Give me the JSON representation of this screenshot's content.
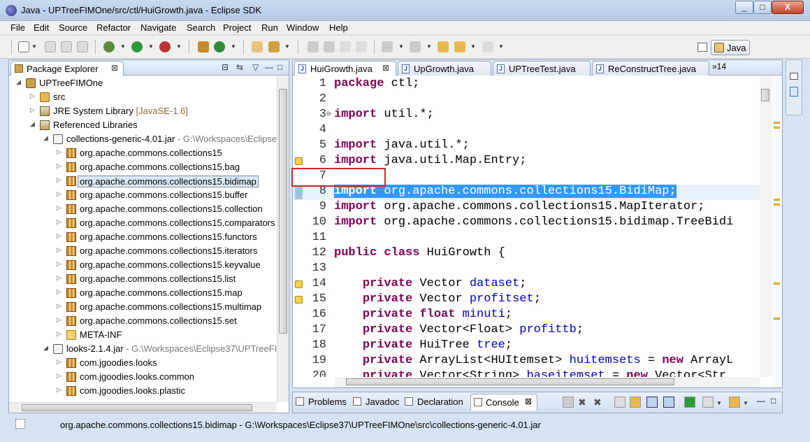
{
  "window": {
    "title": "Java - UPTreeFIMOne/src/ctl/HuiGrowth.java - Eclipse SDK",
    "controls": [
      "_",
      "□",
      "X"
    ]
  },
  "menu": [
    "File",
    "Edit",
    "Source",
    "Refactor",
    "Navigate",
    "Search",
    "Project",
    "Run",
    "Window",
    "Help"
  ],
  "perspective": {
    "label": "Java"
  },
  "package_explorer": {
    "title": "Package Explorer",
    "close": "⊠",
    "controls": [
      "⊟",
      "⇆",
      "▽",
      "—",
      "□"
    ],
    "tree": [
      {
        "label": "UPTreeFIMOne",
        "arrow": "◢",
        "icon": "project",
        "indent": 0
      },
      {
        "label": "src",
        "arrow": "▷",
        "icon": "src",
        "indent": 1
      },
      {
        "label": "JRE System Library",
        "suffix": "[JavaSE-1.6]",
        "arrow": "▷",
        "icon": "lib",
        "indent": 1
      },
      {
        "label": "Referenced Libraries",
        "arrow": "◢",
        "icon": "lib",
        "indent": 1
      },
      {
        "label": "collections-generic-4.01.jar",
        "path": " - G:\\Workspaces\\Eclipse",
        "arrow": "◢",
        "icon": "jar",
        "indent": 2
      },
      {
        "label": "org.apache.commons.collections15",
        "arrow": "▷",
        "icon": "pkg",
        "indent": 3
      },
      {
        "label": "org.apache.commons.collections15.bag",
        "arrow": "▷",
        "icon": "pkg",
        "indent": 3
      },
      {
        "label": "org.apache.commons.collections15.bidimap",
        "arrow": "▷",
        "icon": "pkg",
        "indent": 3,
        "selected": true
      },
      {
        "label": "org.apache.commons.collections15.buffer",
        "arrow": "▷",
        "icon": "pkg",
        "indent": 3
      },
      {
        "label": "org.apache.commons.collections15.collection",
        "arrow": "▷",
        "icon": "pkg",
        "indent": 3
      },
      {
        "label": "org.apache.commons.collections15.comparators",
        "arrow": "▷",
        "icon": "pkg",
        "indent": 3
      },
      {
        "label": "org.apache.commons.collections15.functors",
        "arrow": "▷",
        "icon": "pkg",
        "indent": 3
      },
      {
        "label": "org.apache.commons.collections15.iterators",
        "arrow": "▷",
        "icon": "pkg",
        "indent": 3
      },
      {
        "label": "org.apache.commons.collections15.keyvalue",
        "arrow": "▷",
        "icon": "pkg",
        "indent": 3
      },
      {
        "label": "org.apache.commons.collections15.list",
        "arrow": "▷",
        "icon": "pkg",
        "indent": 3
      },
      {
        "label": "org.apache.commons.collections15.map",
        "arrow": "▷",
        "icon": "pkg",
        "indent": 3
      },
      {
        "label": "org.apache.commons.collections15.multimap",
        "arrow": "▷",
        "icon": "pkg",
        "indent": 3
      },
      {
        "label": "org.apache.commons.collections15.set",
        "arrow": "▷",
        "icon": "pkg",
        "indent": 3
      },
      {
        "label": "META-INF",
        "arrow": "▷",
        "icon": "folder",
        "indent": 3
      },
      {
        "label": "looks-2.1.4.jar",
        "path": " - G:\\Workspaces\\Eclipse37\\UPTreeFI",
        "arrow": "◢",
        "icon": "jar",
        "indent": 2
      },
      {
        "label": "com.jgoodies.looks",
        "arrow": "▷",
        "icon": "pkg",
        "indent": 3
      },
      {
        "label": "com.jgoodies.looks.common",
        "arrow": "▷",
        "icon": "pkg",
        "indent": 3
      },
      {
        "label": "com.jgoodies.looks.plastic",
        "arrow": "▷",
        "icon": "pkg",
        "indent": 3
      }
    ]
  },
  "editor": {
    "tabs": [
      {
        "label": "HuiGrowth.java",
        "active": true,
        "close": "⊠"
      },
      {
        "label": "UpGrowth.java"
      },
      {
        "label": "UPTreeTest.java"
      },
      {
        "label": "ReConstructTree.java"
      }
    ],
    "overflow": "»14",
    "lines": [
      {
        "n": "1",
        "tokens": [
          [
            "kw",
            "package"
          ],
          [
            "t",
            " ctl;"
          ]
        ]
      },
      {
        "n": "2",
        "tokens": []
      },
      {
        "n": "3",
        "fold": "⊖",
        "tokens": [
          [
            "kw",
            "import"
          ],
          [
            "t",
            " util.*;"
          ]
        ]
      },
      {
        "n": "4",
        "tokens": []
      },
      {
        "n": "5",
        "tokens": [
          [
            "kw",
            "import"
          ],
          [
            "t",
            " java.util.*;"
          ]
        ]
      },
      {
        "n": "6",
        "marker": "warning",
        "tokens": [
          [
            "kw",
            "import"
          ],
          [
            "t",
            " java.util.Map.Entry;"
          ]
        ]
      },
      {
        "n": "7",
        "tokens": []
      },
      {
        "n": "8",
        "marker": "bar",
        "highlight": true,
        "tokens": [
          [
            "kwsel",
            "import"
          ],
          [
            "sel",
            " org.apache.commons.collections15.BidiMap;"
          ]
        ]
      },
      {
        "n": "9",
        "tokens": [
          [
            "kw",
            "import"
          ],
          [
            "t",
            " org.apache.commons.collections15.MapIterator;"
          ]
        ]
      },
      {
        "n": "10",
        "tokens": [
          [
            "kw",
            "import"
          ],
          [
            "t",
            " org.apache.commons.collections15.bidimap.TreeBidi"
          ]
        ]
      },
      {
        "n": "11",
        "tokens": []
      },
      {
        "n": "12",
        "tokens": [
          [
            "kw",
            "public"
          ],
          [
            "t",
            " "
          ],
          [
            "kw",
            "class"
          ],
          [
            "t",
            " HuiGrowth {"
          ]
        ]
      },
      {
        "n": "13",
        "tokens": []
      },
      {
        "n": "14",
        "marker": "warning",
        "tokens": [
          [
            "t",
            "    "
          ],
          [
            "kw",
            "private"
          ],
          [
            "t",
            " Vector "
          ],
          [
            "fld",
            "dataset"
          ],
          [
            "t",
            ";"
          ]
        ]
      },
      {
        "n": "15",
        "marker": "warning",
        "tokens": [
          [
            "t",
            "    "
          ],
          [
            "kw",
            "private"
          ],
          [
            "t",
            " Vector "
          ],
          [
            "fld",
            "profitset"
          ],
          [
            "t",
            ";"
          ]
        ]
      },
      {
        "n": "16",
        "tokens": [
          [
            "t",
            "    "
          ],
          [
            "kw",
            "private"
          ],
          [
            "t",
            " "
          ],
          [
            "kw",
            "float"
          ],
          [
            "t",
            " "
          ],
          [
            "fld",
            "minuti"
          ],
          [
            "t",
            ";"
          ]
        ]
      },
      {
        "n": "17",
        "tokens": [
          [
            "t",
            "    "
          ],
          [
            "kw",
            "private"
          ],
          [
            "t",
            " Vector<Float> "
          ],
          [
            "fld",
            "profittb"
          ],
          [
            "t",
            ";"
          ]
        ]
      },
      {
        "n": "18",
        "tokens": [
          [
            "t",
            "    "
          ],
          [
            "kw",
            "private"
          ],
          [
            "t",
            " HuiTree "
          ],
          [
            "fld",
            "tree"
          ],
          [
            "t",
            ";"
          ]
        ]
      },
      {
        "n": "19",
        "tokens": [
          [
            "t",
            "    "
          ],
          [
            "kw",
            "private"
          ],
          [
            "t",
            " ArrayList<HUItemset> "
          ],
          [
            "fld",
            "huitemsets"
          ],
          [
            "t",
            " = "
          ],
          [
            "kw",
            "new"
          ],
          [
            "t",
            " ArrayL"
          ]
        ]
      },
      {
        "n": "20",
        "tokens": [
          [
            "t",
            "    "
          ],
          [
            "kw",
            "private"
          ],
          [
            "t",
            " Vector<String> "
          ],
          [
            "fld",
            "baseitemset"
          ],
          [
            "t",
            " = "
          ],
          [
            "kw",
            "new"
          ],
          [
            "t",
            " Vector<Str"
          ]
        ]
      }
    ]
  },
  "bottom_tabs": [
    {
      "label": "Problems",
      "icon": "problems-icon"
    },
    {
      "label": "Javadoc",
      "icon": "at-icon"
    },
    {
      "label": "Declaration",
      "icon": "declaration-icon"
    },
    {
      "label": "Console",
      "icon": "console-icon",
      "active": true,
      "close": "⊠"
    }
  ],
  "status": {
    "text": "org.apache.commons.collections15.bidimap - G:\\Workspaces\\Eclipse37\\UPTreeFIMOne\\src\\collections-generic-4.01.jar"
  },
  "colors": {
    "keyword": "#7f0055",
    "field": "#0000c0",
    "selection": "#3399ff",
    "annotation_box": "#d9242b"
  }
}
